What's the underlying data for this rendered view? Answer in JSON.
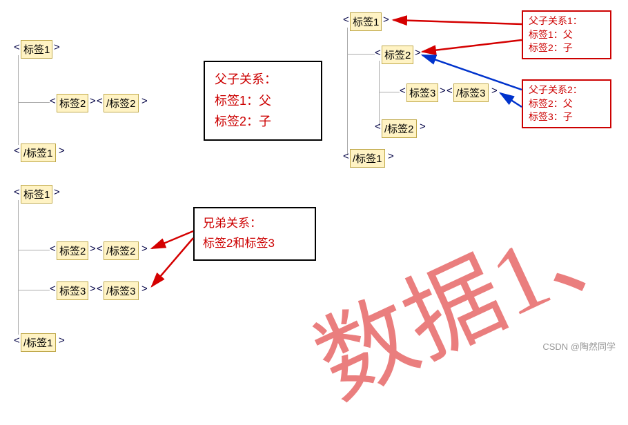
{
  "left_block": {
    "t1_open": "标签1",
    "t2_open": "标签2",
    "t2_close": "/标签2",
    "t1_close": "/标签1"
  },
  "center_box": {
    "title": "父子关系：",
    "line1": "标签1：父",
    "line2": "标签2：子"
  },
  "right_block": {
    "t1_open": "标签1",
    "t2_open": "标签2",
    "t3_open": "标签3",
    "t3_close": "/标签3",
    "t2_close": "/标签2",
    "t1_close": "/标签1"
  },
  "right_box1": {
    "title": "父子关系1：",
    "line1": "标签1：父",
    "line2": "标签2：子"
  },
  "right_box2": {
    "title": "父子关系2：",
    "line1": "标签2：父",
    "line2": "标签3：子"
  },
  "bottom_left": {
    "t1_open": "标签1",
    "t2_open": "标签2",
    "t2_close": "/标签2",
    "t3_open": "标签3",
    "t3_close": "/标签3",
    "t1_close": "/标签1"
  },
  "sibling_box": {
    "title": "兄弟关系：",
    "line1": "标签2和标签3"
  },
  "watermark": "数据1、",
  "credit": "CSDN @陶然同学"
}
